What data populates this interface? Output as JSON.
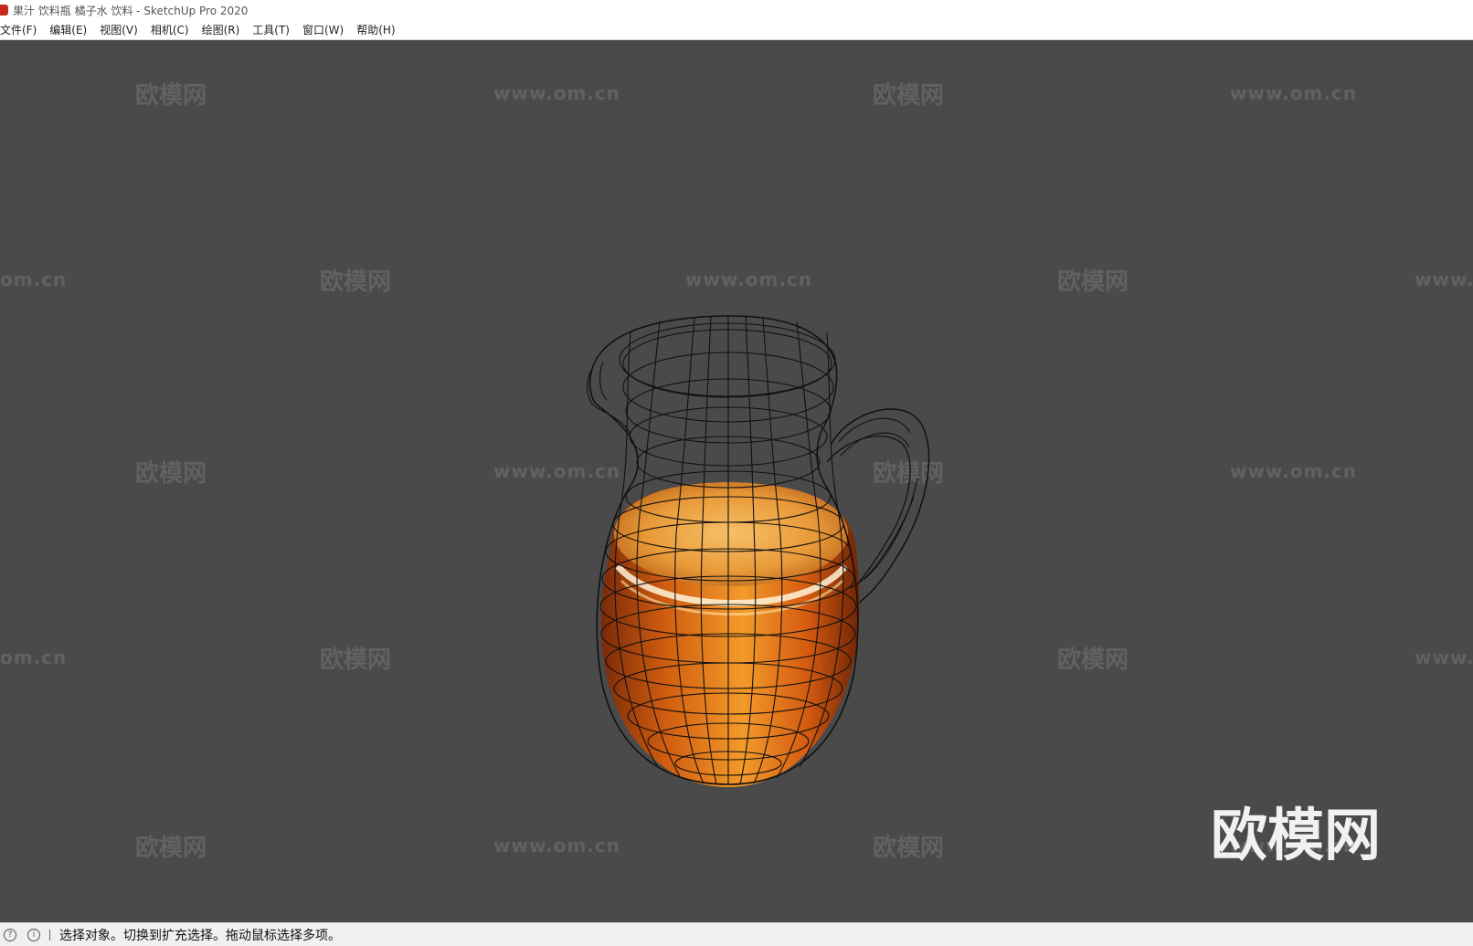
{
  "window": {
    "title": "果汁 饮料瓶 橘子水 饮料 - SketchUp Pro 2020"
  },
  "menu": [
    "文件(F)",
    "编辑(E)",
    "视图(V)",
    "相机(C)",
    "绘图(R)",
    "工具(T)",
    "窗口(W)",
    "帮助(H)"
  ],
  "watermark": {
    "brand": "欧模网",
    "url": "www.om.cn",
    "edge_url_left": "om.cn",
    "edge_url_right": "www.",
    "large": "欧模网"
  },
  "status": {
    "message": "选择对象。切换到扩充选择。拖动鼠标选择多项。"
  },
  "colors": {
    "viewport": "#4a4a4a",
    "juice": "#e07818",
    "wireframe": "#111111"
  }
}
